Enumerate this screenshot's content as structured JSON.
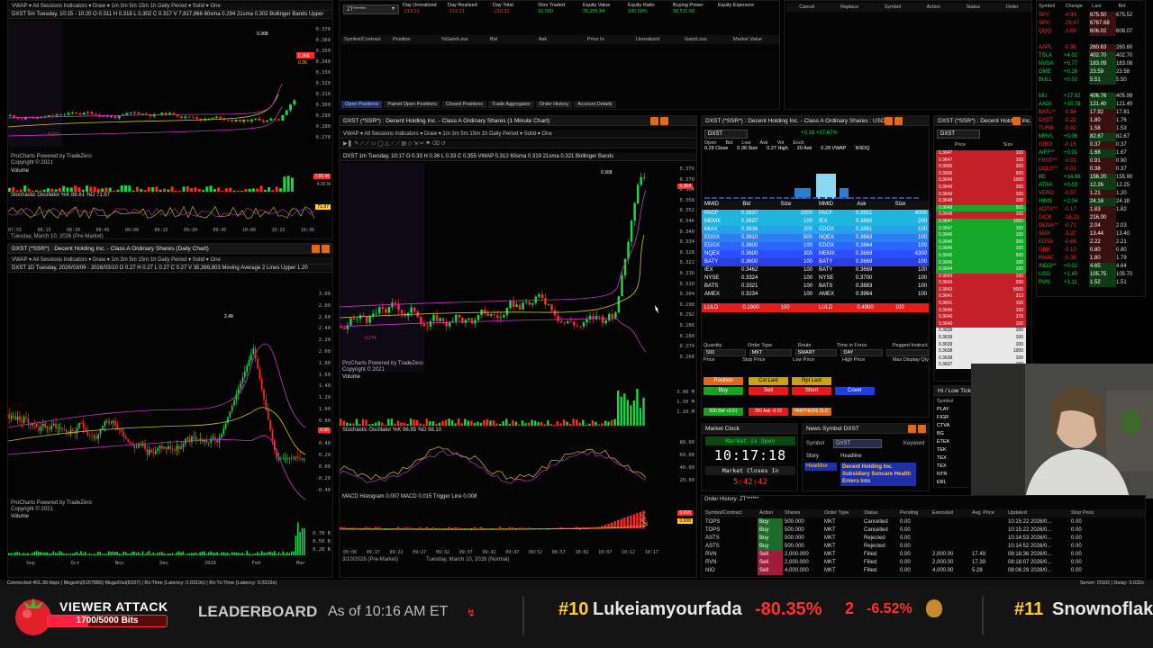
{
  "colors": {
    "green": "#18d84a",
    "red": "#ff2a2a",
    "orange": "#e06a1a",
    "blue": "#1f6cff",
    "gold": "#ffcc33",
    "bg": "#050505"
  },
  "chart_tl": {
    "toolbar": "VWAP ▾   All Sessions   Indicators ▾   Draw ▾   1m   3m   5m   15m   1h   Daily   Period ▾   Solid ▾   One",
    "sym_line": "DXST 5m  Tuesday, 10:15 - 10:20  O 0.311  H 0.318  L 0.302  C 0.317  V 7,817,866   60sma 0.294   21sma 0.302   Bollinger Bands   Upper",
    "yticks": [
      "0.370",
      "0.360",
      "0.350",
      "0.340",
      "0.330",
      "0.320",
      "0.310",
      "0.300",
      "0.290",
      "0.280",
      "0.270"
    ],
    "price_badge": "0.364",
    "price_badge2": "0.36",
    "peak_label": "0.368",
    "low_label": "0.277",
    "credit1": "ProCharts Powered by TradeZero",
    "credit2": "Copyright © 2021",
    "volume_label": "Volume",
    "vol_ticks": [
      "7.82 M",
      "4.00 M"
    ],
    "stoch_label": "Stochastic Oscillator  %K 88.61  %D 71.97",
    "stoch_badge": "71.97",
    "xticks": [
      "07:55",
      "08:15",
      "08:30",
      "08:45",
      "09:00",
      "09:15",
      "09:30",
      "09:45",
      "10:00",
      "10:15",
      "10:36"
    ],
    "date": "Tuesday, March 10, 2026 (Pre-Market)"
  },
  "chart_bl": {
    "title": "DXST (*SSR*) : Decent Holding Inc. - Class A Ordinary Shares (Daily Chart)",
    "toolbar": "VWAP ▾   All Sessions   Indicators ▾   Draw ▾   1m   3m   5m   15m   1h   Daily   Period ▾   Solid ▾   One",
    "sym_line": "DXST 1D  Tuesday, 2026/03/09 - 2026/03/10  O 0.27  H 0.27  L 0.27  C 0.27  V 35,369,803   Moving Average 2 Lines   Upper 1.20",
    "yticks": [
      "3.00",
      "2.80",
      "2.60",
      "2.40",
      "2.20",
      "2.00",
      "1.80",
      "1.60",
      "1.40",
      "1.20",
      "1.00",
      "0.80",
      "0.60",
      "0.40",
      "0.20",
      "0.00",
      "-0.20",
      "-0.40"
    ],
    "peak_label": "2.48",
    "badge": "0.36",
    "credit1": "ProCharts Powered by TradeZero",
    "credit2": "Copyright © 2021",
    "volume_label": "Volume",
    "vol_ticks": [
      "0.78 B",
      "0.50 B",
      "0.28 B"
    ],
    "xticks": [
      "Sep",
      "Oct",
      "Nov",
      "Dec",
      "2026",
      "Feb",
      "Mar"
    ]
  },
  "account": {
    "acct": "ZT******",
    "fields": [
      {
        "label": "Day Unrealized",
        "value": "-219.31"
      },
      {
        "label": "Day Realized",
        "value": "-219.31"
      },
      {
        "label": "Day Total",
        "value": "-219.31"
      },
      {
        "label": "Shrs Traded",
        "value": "16,000"
      },
      {
        "label": "Equity Value",
        "value": "29,255.84"
      },
      {
        "label": "Equity Ratio",
        "value": "100.00%"
      },
      {
        "label": "Buying Power",
        "value": "58,511.68"
      },
      {
        "label": "Equity Exposure",
        "value": ""
      }
    ],
    "columns": [
      "Symbol/Contract",
      "Position",
      "%Gain/Loss",
      "Bid",
      "Ask",
      "Price In",
      "Unrealized",
      "Gain/Loss",
      "Market Value"
    ],
    "tabs": [
      "Open Positions",
      "Paired Open Positions",
      "Closed Positions",
      "Trade Aggregator",
      "Order History",
      "Account Details"
    ]
  },
  "orders_top": {
    "columns": [
      "Cancel",
      "Replace",
      "Symbol",
      "Action",
      "Status",
      "Order"
    ]
  },
  "watchlist": {
    "columns": [
      "Symbol",
      "Change",
      "Last",
      "Bid"
    ],
    "rows": [
      {
        "sym": "SPY",
        "chg": "-4.93",
        "last": "675.50",
        "bid": "675.52",
        "state": "neg"
      },
      {
        "sym": "SPX",
        "chg": "-29.47",
        "last": "6767.68",
        "bid": "",
        "state": "neg"
      },
      {
        "sym": "QQQ",
        "chg": "-1.69",
        "last": "606.02",
        "bid": "608.07",
        "state": "neg"
      },
      {
        "sym": "",
        "chg": "",
        "last": "",
        "bid": "",
        "state": "none"
      },
      {
        "sym": "AAPL",
        "chg": "-0.98",
        "last": "260.63",
        "bid": "260.60",
        "state": "neg"
      },
      {
        "sym": "TSLA",
        "chg": "+4.02",
        "last": "402.70",
        "bid": "402.70",
        "state": "pos"
      },
      {
        "sym": "NVDA",
        "chg": "+0.77",
        "last": "183.09",
        "bid": "183.08",
        "state": "pos"
      },
      {
        "sym": "GME",
        "chg": "+0.26",
        "last": "23.59",
        "bid": "23.58",
        "state": "pos"
      },
      {
        "sym": "BULL",
        "chg": "+0.02",
        "last": "5.51",
        "bid": "5.50",
        "state": "pos"
      },
      {
        "sym": "",
        "chg": "",
        "last": "",
        "bid": "",
        "state": "none"
      },
      {
        "sym": "MU",
        "chg": "+17.02",
        "last": "406.76",
        "bid": "405.99",
        "state": "pos"
      },
      {
        "sym": "AADI",
        "chg": "+10.78",
        "last": "121.40",
        "bid": "121.40",
        "state": "pos"
      },
      {
        "sym": "BATL**",
        "chg": "-0.84",
        "last": "17.92",
        "bid": "17.81",
        "state": "neg"
      },
      {
        "sym": "DXST",
        "chg": "-0.22",
        "last": "1.80",
        "bid": "1.76",
        "state": "neg"
      },
      {
        "sym": "TURB",
        "chg": "-0.02",
        "last": "1.58",
        "bid": "1.53",
        "state": "neg"
      },
      {
        "sym": "MRVL",
        "chg": "+0.06",
        "last": "82.67",
        "bid": "82.67",
        "state": "pos"
      },
      {
        "sym": "GIBO",
        "chg": "-0.15",
        "last": "0.37",
        "bid": "0.37",
        "state": "neg"
      },
      {
        "sym": "AIFF**",
        "chg": "+0.01",
        "last": "1.68",
        "bid": "1.67",
        "state": "pos"
      },
      {
        "sym": "FRST**",
        "chg": "-0.03",
        "last": "0.91",
        "bid": "0.90",
        "state": "neg"
      },
      {
        "sym": "DCLS**",
        "chg": "-0.02",
        "last": "0.38",
        "bid": "0.37",
        "state": "neg"
      },
      {
        "sym": "BE",
        "chg": "+14.86",
        "last": "156.20",
        "bid": "155.90",
        "state": "pos"
      },
      {
        "sym": "ATRA",
        "chg": "+0.03",
        "last": "12.26",
        "bid": "12.25",
        "state": "pos"
      },
      {
        "sym": "VERO",
        "chg": "-0.07",
        "last": "1.21",
        "bid": "1.20",
        "state": "neg"
      },
      {
        "sym": "HIMS",
        "chg": "+2.04",
        "last": "24.18",
        "bid": "24.18",
        "state": "pos"
      },
      {
        "sym": "ADTX**",
        "chg": "-0.17",
        "last": "1.83",
        "bid": "1.82",
        "state": "neg"
      },
      {
        "sym": "DICK",
        "chg": "-16.21",
        "last": "216.00",
        "bid": "",
        "state": "neg"
      },
      {
        "sym": "OLMA**",
        "chg": "-0.71",
        "last": "2.04",
        "bid": "2.03",
        "state": "neg"
      },
      {
        "sym": "SMX",
        "chg": "-3.27",
        "last": "13.44",
        "bid": "13.40",
        "state": "neg"
      },
      {
        "sym": "EDSA",
        "chg": "-0.68",
        "last": "2.22",
        "bid": "2.21",
        "state": "neg"
      },
      {
        "sym": "GBR",
        "chg": "-0.10",
        "last": "0.80",
        "bid": "0.80",
        "state": "neg"
      },
      {
        "sym": "RNAC",
        "chg": "-0.38",
        "last": "1.80",
        "bid": "1.79",
        "state": "neg"
      },
      {
        "sym": "INDO**",
        "chg": "+0.02",
        "last": "4.65",
        "bid": "4.64",
        "state": "pos"
      },
      {
        "sym": "USO",
        "chg": "+1.45",
        "last": "105.75",
        "bid": "105.70",
        "state": "pos"
      },
      {
        "sym": "RVN",
        "chg": "+1.11",
        "last": "1.52",
        "bid": "1.51",
        "state": "pos"
      }
    ]
  },
  "chart_mid": {
    "title": "DXST (*SSR*) : Decent Holding Inc. - Class A Ordinary Shares (1 Minute Chart)",
    "toolbar": "VWAP ▾   All Sessions   Indicators ▾   Draw ▾   1m   3m   5m   15m   1h   Daily   Period ▾   Solid ▾   One",
    "sym_line": "DXST 1m  Tuesday, 10:17  O 0.33  H 0.36  L 0.33  C 0.355   VWAP 0.312   60sma 0.319   21sma 0.321   Bollinger Bands",
    "yticks": [
      "0.376",
      "0.370",
      "0.364",
      "0.358",
      "0.352",
      "0.346",
      "0.340",
      "0.334",
      "0.328",
      "0.322",
      "0.316",
      "0.310",
      "0.304",
      "0.298",
      "0.292",
      "0.286",
      "0.280",
      "0.274",
      "0.268"
    ],
    "peak_label": "0.368",
    "low_label": "0.274",
    "price_badge": "0.364",
    "credit1": "ProCharts Powered by TradeZero",
    "credit2": "Copyright © 2021",
    "volume_label": "Volume",
    "vol_ticks": [
      "3.00 M",
      "1.50 M",
      "1.10 M"
    ],
    "stoch_label": "Stochastic Oscillator  %K 96.85  %D 98.10",
    "stoch_ticks": [
      "80.00",
      "60.00",
      "40.00",
      "20.00"
    ],
    "macd_label": "MACD  Histogram 0.007  MACD 0.015  Trigger Line 0.008",
    "macd_badges": [
      "0.015",
      "0.008"
    ],
    "xticks": [
      "09:08",
      "09:17",
      "09:22",
      "09:27",
      "09:32",
      "09:37",
      "09:42",
      "09:47",
      "09:52",
      "09:57",
      "10:02",
      "10:07",
      "10:12",
      "10:17"
    ],
    "date1": "3/10/2026 (Pre-Market)",
    "date2": "Tuesday, March 10, 2026 (Normal)"
  },
  "level2": {
    "title": "DXST (*SSR*) : Decent Holding Inc. - Class A Ordinary Shares : USD",
    "symbol": "DXST",
    "quote_labels": [
      "Open",
      "Bid",
      "Low",
      "Ask",
      "Vol",
      "Exch"
    ],
    "quote_vals": [
      "0.29 Close",
      "0.36 Size",
      "0.27 High",
      "20 Ask",
      "0.28 VWAP",
      "NSDQ"
    ],
    "change": "+0.18 +37.67%",
    "cols": [
      "MMID",
      "Bid",
      "Size",
      "MMID",
      "Ask",
      "Size"
    ],
    "rows": [
      {
        "bm": "PACF",
        "b": "0.3637",
        "bs": "2000",
        "am": "PACF",
        "a": "0.3651",
        "as": "4000",
        "c": "#1fb5e0"
      },
      {
        "bm": "MEMX",
        "b": "0.3637",
        "bs": "100",
        "am": "IEX",
        "a": "0.3660",
        "as": "200",
        "c": "#1fb5e0"
      },
      {
        "bm": "MIAX",
        "b": "0.3636",
        "bs": "200",
        "am": "EDGX",
        "a": "0.3661",
        "as": "100",
        "c": "#26a2e8"
      },
      {
        "bm": "EDGX",
        "b": "0.3610",
        "bs": "500",
        "am": "NQEX",
        "a": "0.3663",
        "as": "100",
        "c": "#2b7ff0"
      },
      {
        "bm": "EDGX",
        "b": "0.3600",
        "bs": "100",
        "am": "EDGX",
        "a": "0.3664",
        "as": "100",
        "c": "#2b66ff"
      },
      {
        "bm": "NQEX",
        "b": "0.3600",
        "bs": "300",
        "am": "MEMX",
        "a": "0.3669",
        "as": "4300",
        "c": "#2a4fff"
      },
      {
        "bm": "BATY",
        "b": "0.3600",
        "bs": "100",
        "am": "BATY",
        "a": "0.3669",
        "as": "100",
        "c": "#2a3fe0"
      },
      {
        "bm": "IEX",
        "b": "0.3462",
        "bs": "100",
        "am": "BATY",
        "a": "0.3669",
        "as": "100",
        "c": "#0a0a0a"
      },
      {
        "bm": "NYSE",
        "b": "0.3324",
        "bs": "100",
        "am": "NYSE",
        "a": "0.3700",
        "as": "100",
        "c": "#0a0a0a"
      },
      {
        "bm": "BATS",
        "b": "0.3321",
        "bs": "100",
        "am": "BATS",
        "a": "0.3883",
        "as": "100",
        "c": "#0a0a0a"
      },
      {
        "bm": "AMEX",
        "b": "0.3234",
        "bs": "100",
        "am": "AMEX",
        "a": "0.3964",
        "as": "100",
        "c": "#0a0a0a"
      }
    ],
    "luld": {
      "m": "LULD",
      "b": "0.1900",
      "s": "100",
      "am": "LULD",
      "a": "0.4900",
      "as": "100"
    },
    "order_labels": [
      "Quantity",
      "Order Type",
      "Route",
      "Time in Force",
      "Pegged Instruct."
    ],
    "order_vals": [
      "500",
      "MKT",
      "SMART",
      "DAY",
      ""
    ],
    "order_labels2": [
      "Price",
      "Stop Price",
      "Low Price",
      "High Price",
      "Max Display Qty"
    ],
    "buttons": {
      "position": "Position",
      "cxl_last": "Cxl Last",
      "rpl_last": "Rpl Last",
      "buy": "Buy",
      "sell": "Sell",
      "short": "Short",
      "cover": "Cover"
    },
    "bid500": "500 Bid +0.01",
    "ask250": "250 Ask -0.01",
    "panther": "PANTHERS SUC"
  },
  "tas": {
    "title": "DXST (*SSR*) : Decent Holding Inc. - Cl",
    "sym": "DXST",
    "cols": [
      "Price",
      "Size"
    ],
    "rows": [
      [
        "0.3647",
        "100",
        "r"
      ],
      [
        "0.3647",
        "100",
        "r"
      ],
      [
        "0.3650",
        "300",
        "r"
      ],
      [
        "0.3650",
        "500",
        "r"
      ],
      [
        "0.3649",
        "1000",
        "r"
      ],
      [
        "0.3649",
        "200",
        "r"
      ],
      [
        "0.3649",
        "100",
        "r"
      ],
      [
        "0.3648",
        "100",
        "r"
      ],
      [
        "0.3648",
        "500",
        "g"
      ],
      [
        "0.3648",
        "100",
        "r"
      ],
      [
        "0.3647",
        "1000",
        "g"
      ],
      [
        "0.3647",
        "100",
        "g"
      ],
      [
        "0.3646",
        "100",
        "g"
      ],
      [
        "0.3646",
        "200",
        "g"
      ],
      [
        "0.3646",
        "100",
        "g"
      ],
      [
        "0.3645",
        "500",
        "g"
      ],
      [
        "0.3645",
        "100",
        "g"
      ],
      [
        "0.3644",
        "100",
        "g"
      ],
      [
        "0.3643",
        "100",
        "r"
      ],
      [
        "0.3643",
        "200",
        "r"
      ],
      [
        "0.3643",
        "5000",
        "r"
      ],
      [
        "0.3641",
        "313",
        "r"
      ],
      [
        "0.3641",
        "100",
        "r"
      ],
      [
        "0.3640",
        "100",
        "r"
      ],
      [
        "0.3640",
        "376",
        "r"
      ],
      [
        "0.3640",
        "100",
        "r"
      ],
      [
        "0.3639",
        "100",
        "d"
      ],
      [
        "0.3639",
        "100",
        "d"
      ],
      [
        "0.3639",
        "100",
        "d"
      ],
      [
        "0.3638",
        "1000",
        "d"
      ],
      [
        "0.3638",
        "100",
        "d"
      ],
      [
        "0.3637",
        "100",
        "d"
      ]
    ]
  },
  "ticker": {
    "title": "Hi / Low Ticker",
    "col": "Symbol",
    "rows": [
      "PLAY",
      "FIGR",
      "CTVA",
      "BG",
      "ETEK",
      "TEK",
      "TEX",
      "TEX",
      "NTR",
      "ERL"
    ]
  },
  "clock": {
    "title": "Market Clock",
    "status": "Market is Open",
    "time": "10:17:18",
    "closes_label": "Market Closes In",
    "countdown": "5:42:42"
  },
  "news": {
    "title": "News Symbol DXST",
    "sym_label": "Symbol",
    "sym_value": "DXST",
    "keyword_label": "Keyword",
    "story_label": "Story",
    "headline_label": "Headline",
    "headline_tab": "Headline",
    "headline": "Decent Holding Inc. Subsidiary Suncare Health Enters Into"
  },
  "order_history": {
    "title": "Order History: ZT******",
    "cols": [
      "Symbol/Contract",
      "Action",
      "Shares",
      "Order Type",
      "Status",
      "Pending",
      "Executed",
      "Avg. Price",
      "Updated",
      "Stop Price"
    ],
    "rows": [
      {
        "sym": "TOPS",
        "act": "Buy",
        "sh": "500.000",
        "type": "MKT",
        "st": "Cancelled",
        "pend": "0.00",
        "exe": "",
        "avg": "",
        "upd": "10:15:22 2026/0...",
        "stop": "0.00"
      },
      {
        "sym": "TOPS",
        "act": "Buy",
        "sh": "500.000",
        "type": "MKT",
        "st": "Cancelled",
        "pend": "0.00",
        "exe": "",
        "avg": "",
        "upd": "10:15:22 2026/0...",
        "stop": "0.00"
      },
      {
        "sym": "ASTS",
        "act": "Buy",
        "sh": "500.000",
        "type": "MKT",
        "st": "Rejected",
        "pend": "0.00",
        "exe": "",
        "avg": "",
        "upd": "10:14:53 2026/0...",
        "stop": "0.00"
      },
      {
        "sym": "ASTS",
        "act": "Buy",
        "sh": "500.000",
        "type": "MKT",
        "st": "Rejected",
        "pend": "0.00",
        "exe": "",
        "avg": "",
        "upd": "10:14:52 2026/0...",
        "stop": "0.00"
      },
      {
        "sym": "RVN",
        "act": "Sell",
        "sh": "2,000.000",
        "type": "MKT",
        "st": "Filled",
        "pend": "0.00",
        "exe": "2,000.00",
        "avg": "17.49",
        "upd": "08:18:36 2026/0...",
        "stop": "0.00"
      },
      {
        "sym": "RVN",
        "act": "Sell",
        "sh": "2,000.000",
        "type": "MKT",
        "st": "Filled",
        "pend": "0.00",
        "exe": "2,000.00",
        "avg": "17.39",
        "upd": "08:18:07 2026/0...",
        "stop": "0.00"
      },
      {
        "sym": "NIO",
        "act": "Sell",
        "sh": "4,000.000",
        "type": "MKT",
        "st": "Filled",
        "pend": "0.00",
        "exe": "4,000.00",
        "avg": "5.28",
        "upd": "08:06:29 2026/0...",
        "stop": "0.00"
      }
    ]
  },
  "status_bar": {
    "left": "Connected  401.30 kbps | Msgs/In(5157889)  Msgs/Out(8337) | Rx:Time (Latency: 0.0319s) | Rx:Tx:Time (Latency: 0.0319s)",
    "right": "Server: DS02 | Delay: 0.032s"
  },
  "stream": {
    "viewer_attack": "VIEWER ATTACK",
    "bits": "1700/5000 Bits",
    "bits_progress": 0.34,
    "leaderboard": "LEADERBOARD",
    "as_of": "As of 10:16 AM ET",
    "entries": [
      {
        "rank": "#10",
        "name": "Lukeiamyourfada",
        "pct": "-80.35%",
        "count": "2",
        "pct2": "-6.52%"
      },
      {
        "rank": "#11",
        "name": "Snownoflake"
      }
    ]
  }
}
